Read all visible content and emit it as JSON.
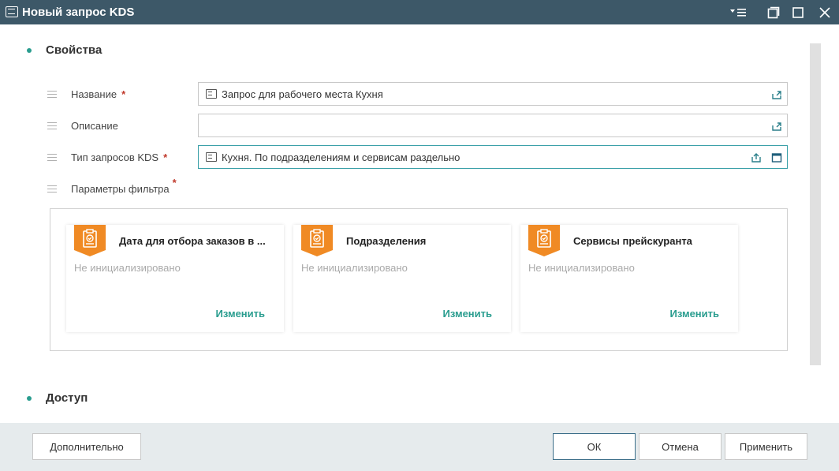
{
  "window": {
    "title": "Новый запрос KDS",
    "controls": [
      "menu-icon",
      "restore-icon",
      "maximize-icon",
      "close-icon"
    ]
  },
  "sections": {
    "properties": "Свойства",
    "access": "Доступ"
  },
  "fields": {
    "name": {
      "label": "Название",
      "required": "*",
      "value": "Запрос для рабочего места Кухня"
    },
    "description": {
      "label": "Описание",
      "value": ""
    },
    "kds_type": {
      "label": "Тип запросов KDS",
      "required": "*",
      "value": "Кухня. По подразделениям и сервисам раздельно"
    },
    "filter": {
      "label": "Параметры фильтра",
      "required": "*"
    }
  },
  "filter_cards": [
    {
      "title": "Дата для отбора заказов в ...",
      "status": "Не инициализировано",
      "action": "Изменить"
    },
    {
      "title": "Подразделения",
      "status": "Не инициализировано",
      "action": "Изменить"
    },
    {
      "title": "Сервисы прейскуранта",
      "status": "Не инициализировано",
      "action": "Изменить"
    }
  ],
  "footer": {
    "more": "Дополнительно",
    "ok": "ОК",
    "cancel": "Отмена",
    "apply": "Применить"
  },
  "colors": {
    "titlebar": "#3d5868",
    "accent": "#2a9d8f",
    "badge": "#f08a24",
    "required": "#c0392b",
    "footer": "#e6ebed"
  }
}
